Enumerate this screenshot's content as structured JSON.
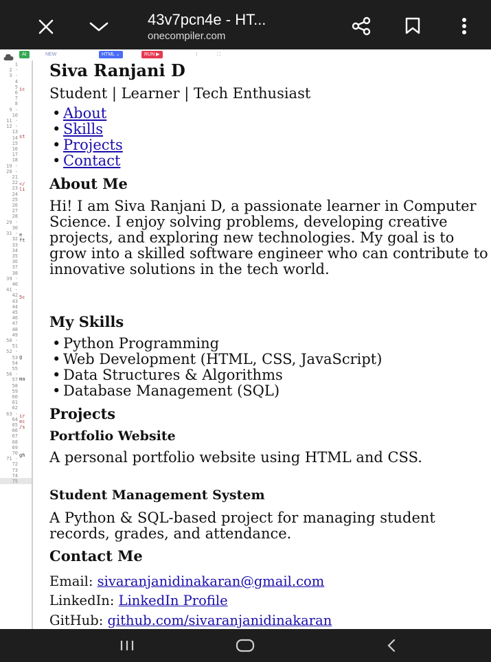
{
  "browser": {
    "title": "43v7pcn4e - HT...",
    "url": "onecompiler.com"
  },
  "editor_toolbar": {
    "ai_label": "AI",
    "new_label": "NEW",
    "lang_label": "HTML",
    "run_label": "RUN"
  },
  "gutter": {
    "line_numbers": "1\n2 -\n3 -\n4\n5\n6\n7\n8\n9 -\n10\n11 -\n12 -\n13\n14\n15\n16\n17\n18\n19 -\n20 -\n21\n22\n23\n24\n25\n26\n27\n28\n29 -\n30\n31 -\n32\n33\n34\n35\n36\n37\n38\n39 -\n40\n41 -\n42\n43\n44\n45\n46\n47\n48\n49\n50 -\n51\n52 -\n53\n54\n55\n56 -\n57\n58\n59\n60\n61\n62\n63 -\n64\n65\n66\n67\n68\n69\n70\n71 -\n72\n73\n74\n75"
  },
  "page": {
    "name": "Siva Ranjani D",
    "tagline": "Student | Learner | Tech Enthusiast",
    "nav": [
      "About",
      "Skills",
      "Projects",
      "Contact"
    ],
    "about": {
      "heading": "About Me",
      "text": "Hi! I am Siva Ranjani D, a passionate learner in Computer Science. I enjoy solving problems, developing creative projects, and exploring new technologies. My goal is to grow into a skilled software engineer who can contribute to innovative solutions in the tech world."
    },
    "skills": {
      "heading": "My Skills",
      "items": [
        "Python Programming",
        "Web Development (HTML, CSS, JavaScript)",
        "Data Structures & Algorithms",
        "Database Management (SQL)"
      ]
    },
    "projects": {
      "heading": "Projects",
      "items": [
        {
          "title": "Portfolio Website",
          "desc": "A personal portfolio website using HTML and CSS."
        },
        {
          "title": "Student Management System",
          "desc": "A Python & SQL-based project for managing student records, grades, and attendance."
        }
      ]
    },
    "contact": {
      "heading": "Contact Me",
      "email_label": "Email:",
      "email": "sivaranjanidinakaran@gmail.com",
      "linkedin_label": "LinkedIn:",
      "linkedin": "LinkedIn Profile",
      "github_label": "GitHub:",
      "github": "github.com/sivaranjanidinakaran"
    }
  },
  "colors": {
    "link": "#1a0dab",
    "bar_bg": "#1e1e1e",
    "ai_pill": "#34a853",
    "html_pill": "#4a6cf7",
    "run_pill": "#e53950"
  },
  "icons": [
    "close-icon",
    "chevron-down-icon",
    "share-icon",
    "bookmark-icon",
    "more-vert-icon",
    "cloud-icon",
    "recent-apps-icon",
    "home-icon",
    "back-icon"
  ]
}
